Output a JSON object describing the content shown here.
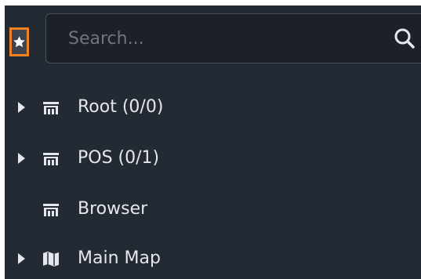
{
  "favorites": {
    "icon": "star-icon",
    "accent": "#f08321"
  },
  "search": {
    "placeholder": "Search...",
    "value": "",
    "icon": "search-icon"
  },
  "tree": {
    "items": [
      {
        "label": "Root (0/0)",
        "icon": "device-group-icon",
        "expandable": true
      },
      {
        "label": "POS (0/1)",
        "icon": "device-group-icon",
        "expandable": true
      },
      {
        "label": "Browser",
        "icon": "device-group-icon",
        "expandable": false
      },
      {
        "label": "Main Map",
        "icon": "map-icon",
        "expandable": true
      }
    ]
  },
  "colors": {
    "panel_bg": "#242a33",
    "text": "#e4e7eb",
    "input_bg": "#1c2129"
  }
}
